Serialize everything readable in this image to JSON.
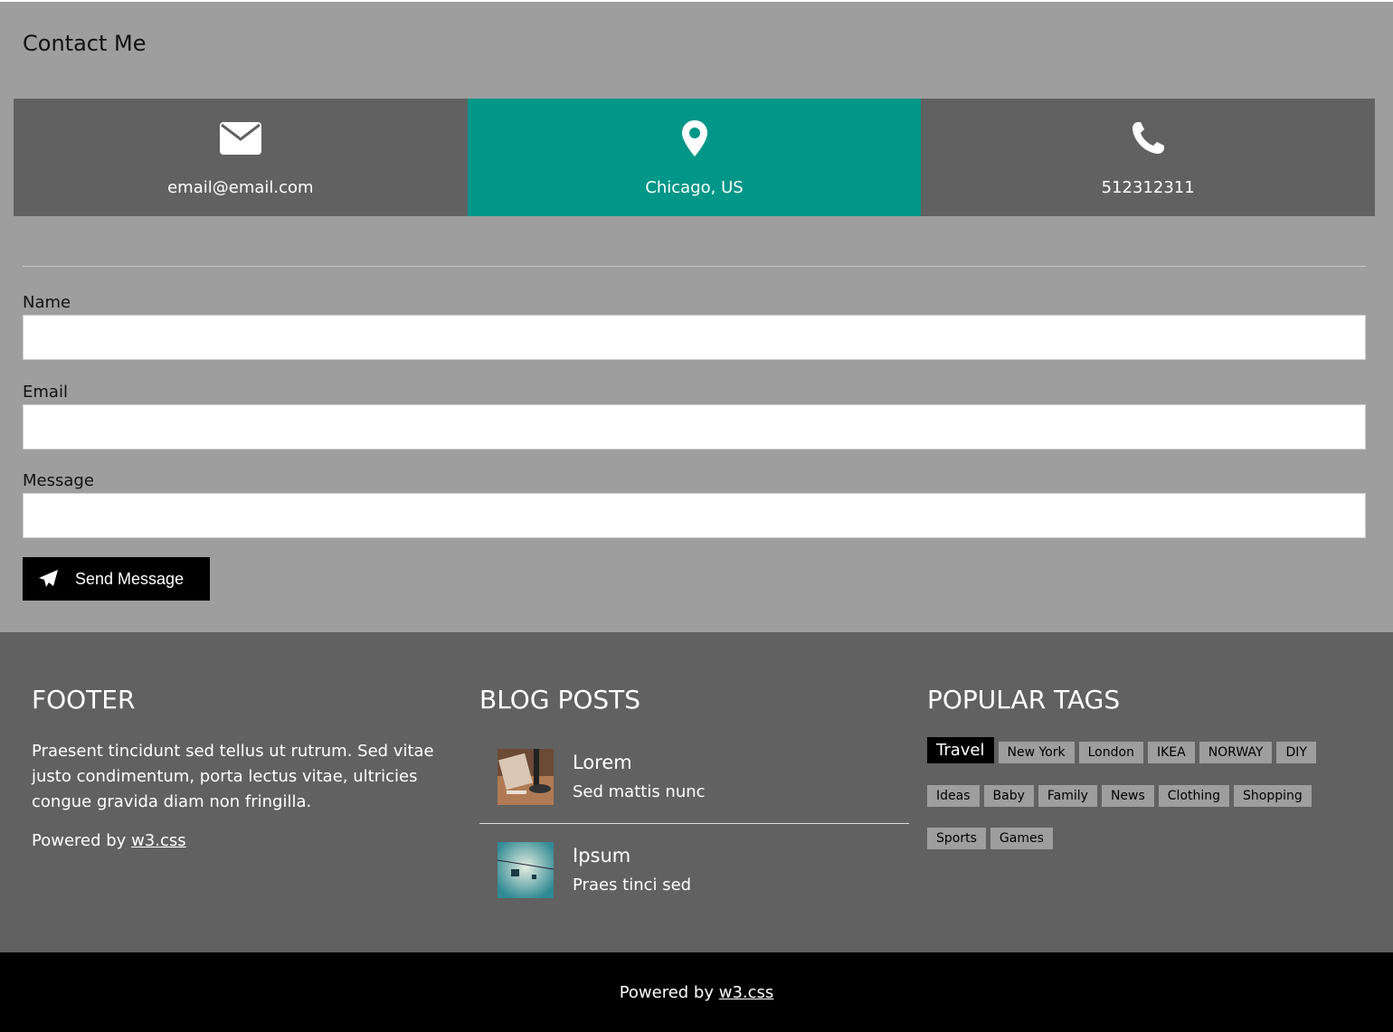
{
  "contact": {
    "title": "Contact Me",
    "email": "email@email.com",
    "location": "Chicago, US",
    "phone": "512312311",
    "form": {
      "name_label": "Name",
      "email_label": "Email",
      "message_label": "Message",
      "send_label": "Send Message"
    }
  },
  "footer": {
    "col1": {
      "title": "FOOTER",
      "text": "Praesent tincidunt sed tellus ut rutrum. Sed vitae justo condimentum, porta lectus vitae, ultricies congue gravida diam non fringilla.",
      "powered_prefix": "Powered by",
      "powered_link": "w3.css"
    },
    "col2": {
      "title": "BLOG POSTS",
      "posts": [
        {
          "title": "Lorem",
          "subtitle": "Sed mattis nunc"
        },
        {
          "title": "Ipsum",
          "subtitle": "Praes tinci sed"
        }
      ]
    },
    "col3": {
      "title": "POPULAR TAGS",
      "tags": [
        "Travel",
        "New York",
        "London",
        "IKEA",
        "NORWAY",
        "DIY",
        "Ideas",
        "Baby",
        "Family",
        "News",
        "Clothing",
        "Shopping",
        "Sports",
        "Games"
      ],
      "active_tag": "Travel"
    }
  },
  "bottom": {
    "powered_prefix": "Powered by",
    "powered_link": "w3.css"
  },
  "colors": {
    "accent": "#009688",
    "panel": "#616161",
    "background": "#9e9e9e"
  }
}
